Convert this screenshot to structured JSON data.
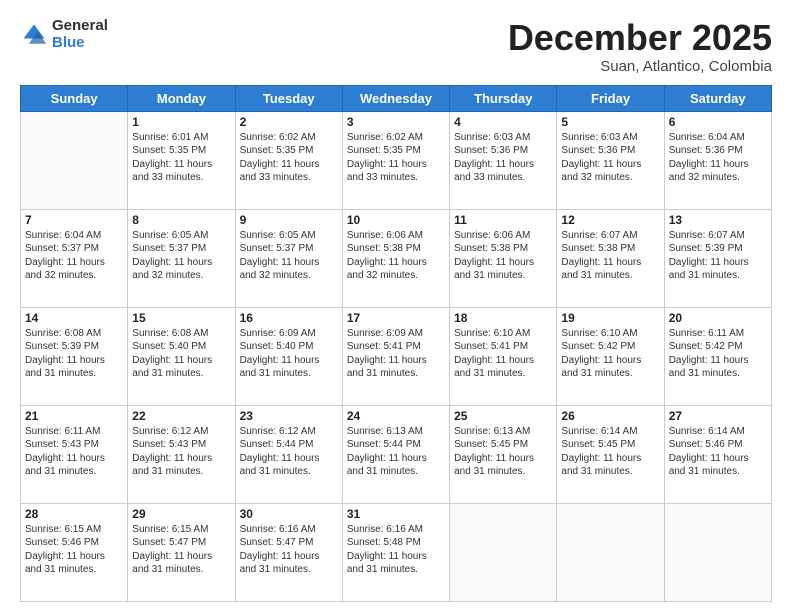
{
  "logo": {
    "general": "General",
    "blue": "Blue"
  },
  "title": {
    "month_year": "December 2025",
    "location": "Suan, Atlantico, Colombia"
  },
  "calendar": {
    "days_of_week": [
      "Sunday",
      "Monday",
      "Tuesday",
      "Wednesday",
      "Thursday",
      "Friday",
      "Saturday"
    ],
    "weeks": [
      [
        {
          "day": "",
          "sunrise": "",
          "sunset": "",
          "daylight": ""
        },
        {
          "day": "1",
          "sunrise": "Sunrise: 6:01 AM",
          "sunset": "Sunset: 5:35 PM",
          "daylight": "Daylight: 11 hours and 33 minutes."
        },
        {
          "day": "2",
          "sunrise": "Sunrise: 6:02 AM",
          "sunset": "Sunset: 5:35 PM",
          "daylight": "Daylight: 11 hours and 33 minutes."
        },
        {
          "day": "3",
          "sunrise": "Sunrise: 6:02 AM",
          "sunset": "Sunset: 5:35 PM",
          "daylight": "Daylight: 11 hours and 33 minutes."
        },
        {
          "day": "4",
          "sunrise": "Sunrise: 6:03 AM",
          "sunset": "Sunset: 5:36 PM",
          "daylight": "Daylight: 11 hours and 33 minutes."
        },
        {
          "day": "5",
          "sunrise": "Sunrise: 6:03 AM",
          "sunset": "Sunset: 5:36 PM",
          "daylight": "Daylight: 11 hours and 32 minutes."
        },
        {
          "day": "6",
          "sunrise": "Sunrise: 6:04 AM",
          "sunset": "Sunset: 5:36 PM",
          "daylight": "Daylight: 11 hours and 32 minutes."
        }
      ],
      [
        {
          "day": "7",
          "sunrise": "Sunrise: 6:04 AM",
          "sunset": "Sunset: 5:37 PM",
          "daylight": "Daylight: 11 hours and 32 minutes."
        },
        {
          "day": "8",
          "sunrise": "Sunrise: 6:05 AM",
          "sunset": "Sunset: 5:37 PM",
          "daylight": "Daylight: 11 hours and 32 minutes."
        },
        {
          "day": "9",
          "sunrise": "Sunrise: 6:05 AM",
          "sunset": "Sunset: 5:37 PM",
          "daylight": "Daylight: 11 hours and 32 minutes."
        },
        {
          "day": "10",
          "sunrise": "Sunrise: 6:06 AM",
          "sunset": "Sunset: 5:38 PM",
          "daylight": "Daylight: 11 hours and 32 minutes."
        },
        {
          "day": "11",
          "sunrise": "Sunrise: 6:06 AM",
          "sunset": "Sunset: 5:38 PM",
          "daylight": "Daylight: 11 hours and 31 minutes."
        },
        {
          "day": "12",
          "sunrise": "Sunrise: 6:07 AM",
          "sunset": "Sunset: 5:38 PM",
          "daylight": "Daylight: 11 hours and 31 minutes."
        },
        {
          "day": "13",
          "sunrise": "Sunrise: 6:07 AM",
          "sunset": "Sunset: 5:39 PM",
          "daylight": "Daylight: 11 hours and 31 minutes."
        }
      ],
      [
        {
          "day": "14",
          "sunrise": "Sunrise: 6:08 AM",
          "sunset": "Sunset: 5:39 PM",
          "daylight": "Daylight: 11 hours and 31 minutes."
        },
        {
          "day": "15",
          "sunrise": "Sunrise: 6:08 AM",
          "sunset": "Sunset: 5:40 PM",
          "daylight": "Daylight: 11 hours and 31 minutes."
        },
        {
          "day": "16",
          "sunrise": "Sunrise: 6:09 AM",
          "sunset": "Sunset: 5:40 PM",
          "daylight": "Daylight: 11 hours and 31 minutes."
        },
        {
          "day": "17",
          "sunrise": "Sunrise: 6:09 AM",
          "sunset": "Sunset: 5:41 PM",
          "daylight": "Daylight: 11 hours and 31 minutes."
        },
        {
          "day": "18",
          "sunrise": "Sunrise: 6:10 AM",
          "sunset": "Sunset: 5:41 PM",
          "daylight": "Daylight: 11 hours and 31 minutes."
        },
        {
          "day": "19",
          "sunrise": "Sunrise: 6:10 AM",
          "sunset": "Sunset: 5:42 PM",
          "daylight": "Daylight: 11 hours and 31 minutes."
        },
        {
          "day": "20",
          "sunrise": "Sunrise: 6:11 AM",
          "sunset": "Sunset: 5:42 PM",
          "daylight": "Daylight: 11 hours and 31 minutes."
        }
      ],
      [
        {
          "day": "21",
          "sunrise": "Sunrise: 6:11 AM",
          "sunset": "Sunset: 5:43 PM",
          "daylight": "Daylight: 11 hours and 31 minutes."
        },
        {
          "day": "22",
          "sunrise": "Sunrise: 6:12 AM",
          "sunset": "Sunset: 5:43 PM",
          "daylight": "Daylight: 11 hours and 31 minutes."
        },
        {
          "day": "23",
          "sunrise": "Sunrise: 6:12 AM",
          "sunset": "Sunset: 5:44 PM",
          "daylight": "Daylight: 11 hours and 31 minutes."
        },
        {
          "day": "24",
          "sunrise": "Sunrise: 6:13 AM",
          "sunset": "Sunset: 5:44 PM",
          "daylight": "Daylight: 11 hours and 31 minutes."
        },
        {
          "day": "25",
          "sunrise": "Sunrise: 6:13 AM",
          "sunset": "Sunset: 5:45 PM",
          "daylight": "Daylight: 11 hours and 31 minutes."
        },
        {
          "day": "26",
          "sunrise": "Sunrise: 6:14 AM",
          "sunset": "Sunset: 5:45 PM",
          "daylight": "Daylight: 11 hours and 31 minutes."
        },
        {
          "day": "27",
          "sunrise": "Sunrise: 6:14 AM",
          "sunset": "Sunset: 5:46 PM",
          "daylight": "Daylight: 11 hours and 31 minutes."
        }
      ],
      [
        {
          "day": "28",
          "sunrise": "Sunrise: 6:15 AM",
          "sunset": "Sunset: 5:46 PM",
          "daylight": "Daylight: 11 hours and 31 minutes."
        },
        {
          "day": "29",
          "sunrise": "Sunrise: 6:15 AM",
          "sunset": "Sunset: 5:47 PM",
          "daylight": "Daylight: 11 hours and 31 minutes."
        },
        {
          "day": "30",
          "sunrise": "Sunrise: 6:16 AM",
          "sunset": "Sunset: 5:47 PM",
          "daylight": "Daylight: 11 hours and 31 minutes."
        },
        {
          "day": "31",
          "sunrise": "Sunrise: 6:16 AM",
          "sunset": "Sunset: 5:48 PM",
          "daylight": "Daylight: 11 hours and 31 minutes."
        },
        {
          "day": "",
          "sunrise": "",
          "sunset": "",
          "daylight": ""
        },
        {
          "day": "",
          "sunrise": "",
          "sunset": "",
          "daylight": ""
        },
        {
          "day": "",
          "sunrise": "",
          "sunset": "",
          "daylight": ""
        }
      ]
    ]
  }
}
